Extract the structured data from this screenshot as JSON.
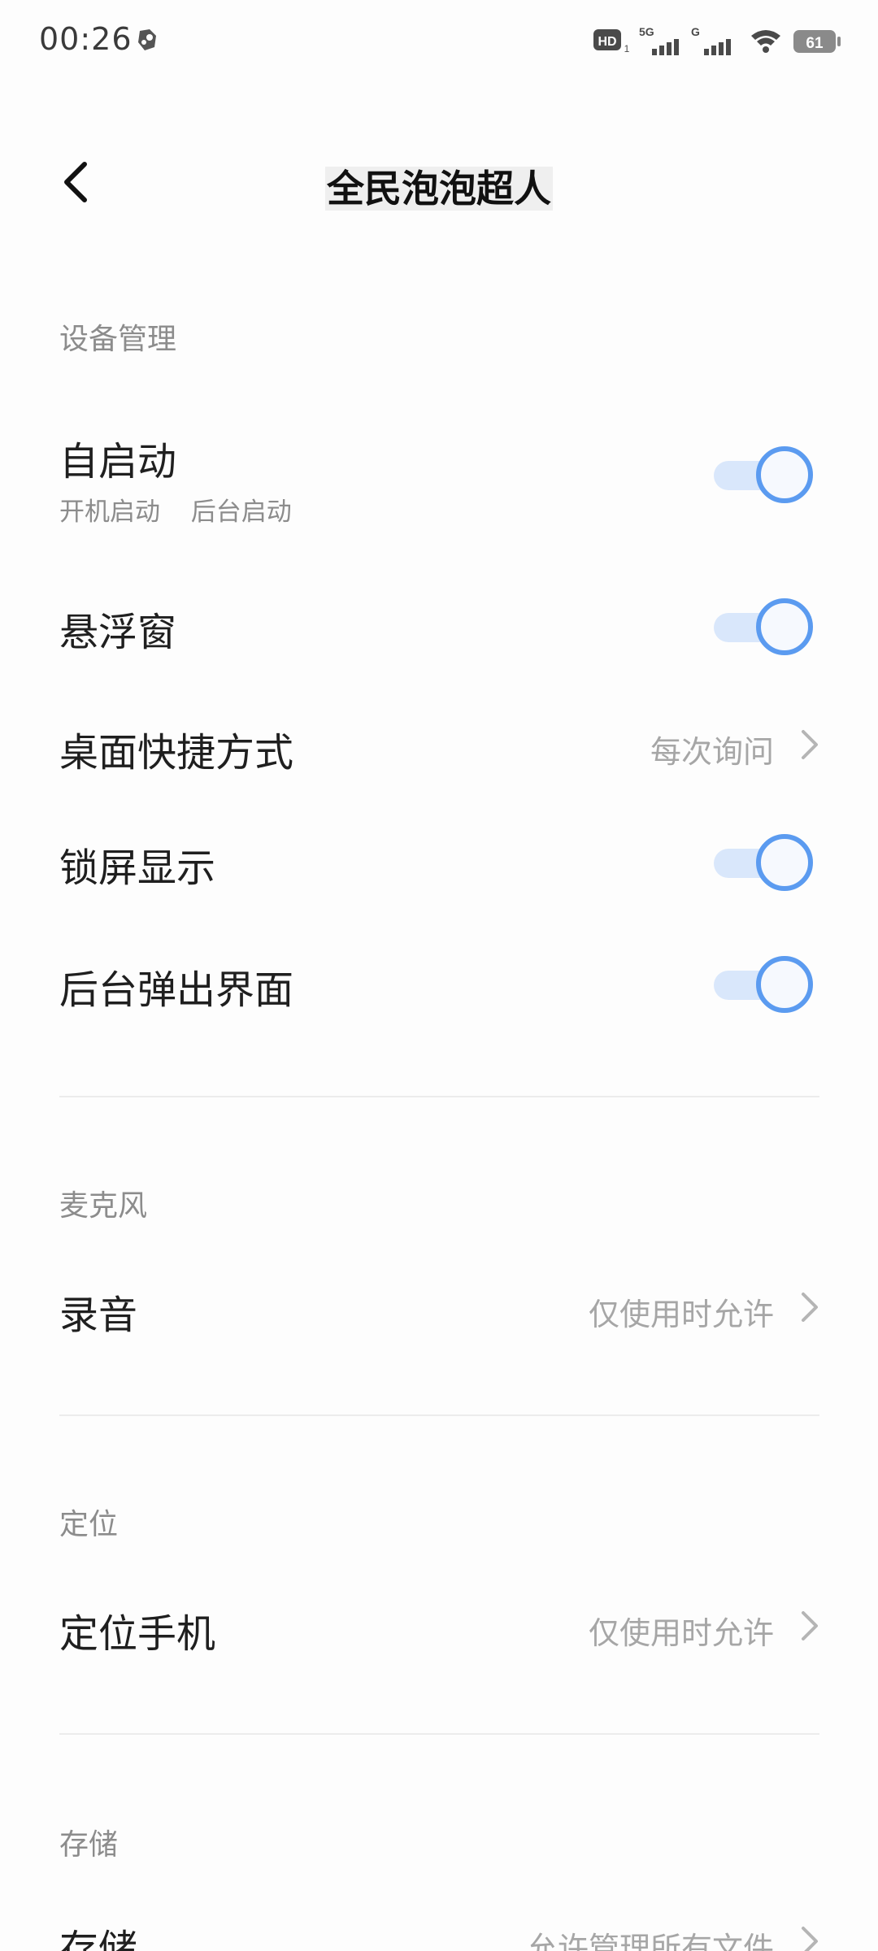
{
  "status_bar": {
    "time": "00:26",
    "hd": "HD",
    "hd_sub": "1",
    "net1": "5G",
    "net2": "G",
    "battery": "61"
  },
  "header": {
    "title": "全民泡泡超人"
  },
  "sections": {
    "device": {
      "label": "设备管理",
      "autostart": {
        "title": "自启动",
        "sub1": "开机启动",
        "sub2": "后台启动",
        "on": true
      },
      "floating": {
        "title": "悬浮窗",
        "on": true
      },
      "shortcut": {
        "title": "桌面快捷方式",
        "value": "每次询问"
      },
      "lockscreen": {
        "title": "锁屏显示",
        "on": true
      },
      "background_popup": {
        "title": "后台弹出界面",
        "on": true
      }
    },
    "mic": {
      "label": "麦克风",
      "record": {
        "title": "录音",
        "value": "仅使用时允许"
      }
    },
    "location": {
      "label": "定位",
      "locate": {
        "title": "定位手机",
        "value": "仅使用时允许"
      }
    },
    "storage": {
      "label": "存储",
      "store": {
        "title": "存储",
        "value": "允许管理所有文件"
      }
    }
  },
  "colors": {
    "toggle_accent": "#5b9bf0",
    "toggle_track": "#d9e7fb",
    "secondary_text": "#8c8c8c"
  }
}
